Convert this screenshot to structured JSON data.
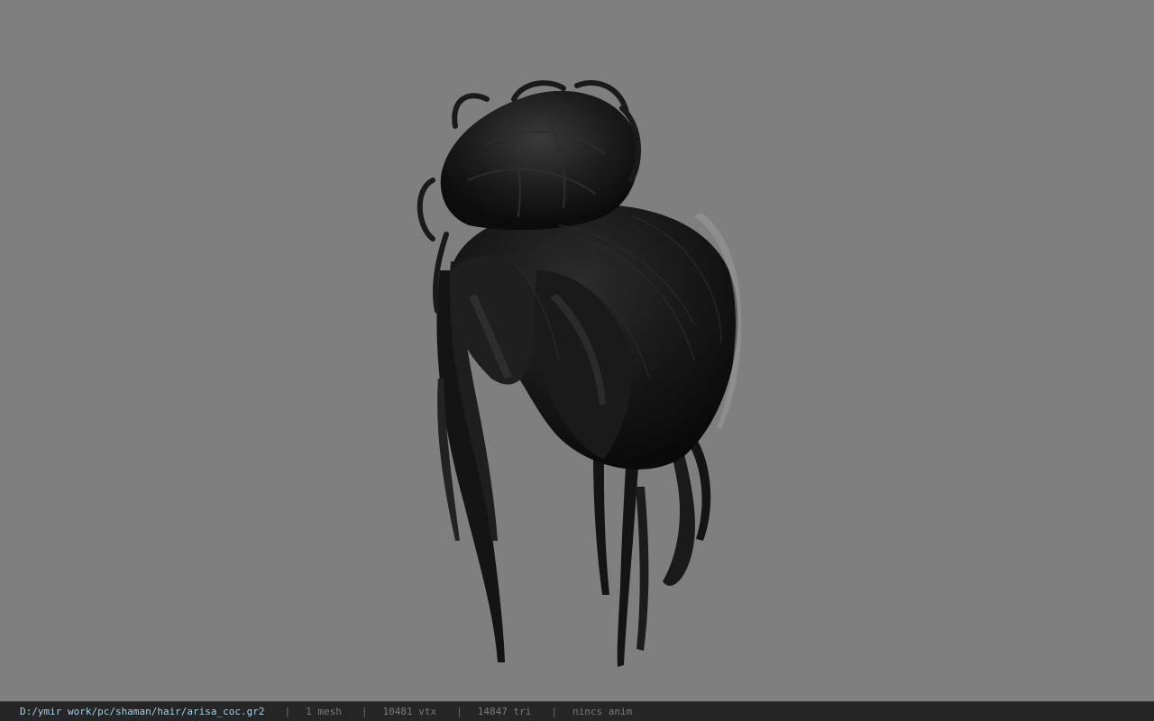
{
  "viewport": {
    "background_color": "#7f7f7f",
    "model_icon": "hair-bun-mesh"
  },
  "statusbar": {
    "file_path": "D:/ymir work/pc/shaman/hair/arisa_coc.gr2",
    "separator": "|",
    "mesh_count": "1 mesh",
    "vertex_count": "10481 vtx",
    "triangle_count": "14847 tri",
    "animation": "nincs anim",
    "path_color": "#9fd0e8"
  }
}
